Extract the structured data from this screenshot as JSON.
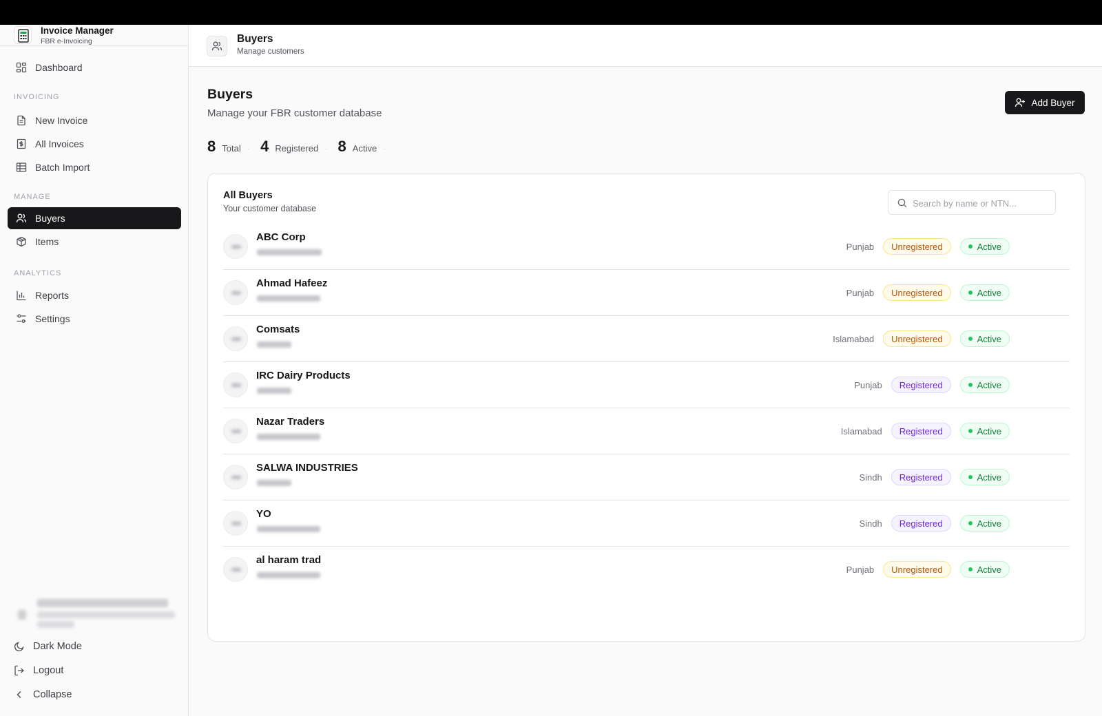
{
  "app": {
    "title": "Invoice Manager",
    "subtitle": "FBR e-Invoicing"
  },
  "sidebar": {
    "dashboard": "Dashboard",
    "sections": {
      "invoicing": "INVOICING",
      "manage": "MANAGE",
      "analytics": "ANALYTICS"
    },
    "items": {
      "new_invoice": "New Invoice",
      "all_invoices": "All Invoices",
      "batch_import": "Batch Import",
      "buyers": "Buyers",
      "items": "Items",
      "reports": "Reports",
      "settings": "Settings"
    },
    "bottom": {
      "dark_mode": "Dark Mode",
      "logout": "Logout",
      "collapse": "Collapse"
    }
  },
  "header": {
    "title": "Buyers",
    "subtitle": "Manage customers"
  },
  "page": {
    "title": "Buyers",
    "subtitle": "Manage your FBR customer database",
    "add_button": "Add Buyer"
  },
  "stats": {
    "total": {
      "value": "8",
      "label": "Total"
    },
    "registered": {
      "value": "4",
      "label": "Registered"
    },
    "active": {
      "value": "8",
      "label": "Active"
    }
  },
  "card": {
    "title": "All Buyers",
    "subtitle": "Your customer database",
    "search_placeholder": "Search by name or NTN..."
  },
  "buyers": [
    {
      "name": "ABC Corp",
      "province": "Punjab",
      "registration": "Unregistered",
      "status": "Active"
    },
    {
      "name": "Ahmad Hafeez",
      "province": "Punjab",
      "registration": "Unregistered",
      "status": "Active"
    },
    {
      "name": "Comsats",
      "province": "Islamabad",
      "registration": "Unregistered",
      "status": "Active"
    },
    {
      "name": "IRC Dairy Products",
      "province": "Punjab",
      "registration": "Registered",
      "status": "Active"
    },
    {
      "name": "Nazar Traders",
      "province": "Islamabad",
      "registration": "Registered",
      "status": "Active"
    },
    {
      "name": "SALWA INDUSTRIES",
      "province": "Sindh",
      "registration": "Registered",
      "status": "Active"
    },
    {
      "name": "YO",
      "province": "Sindh",
      "registration": "Registered",
      "status": "Active"
    },
    {
      "name": "al haram trad",
      "province": "Punjab",
      "registration": "Unregistered",
      "status": "Active"
    }
  ],
  "colors": {
    "primary": "#18181b",
    "unregistered": "#b45309",
    "registered": "#6d28d9",
    "active": "#15803d"
  }
}
